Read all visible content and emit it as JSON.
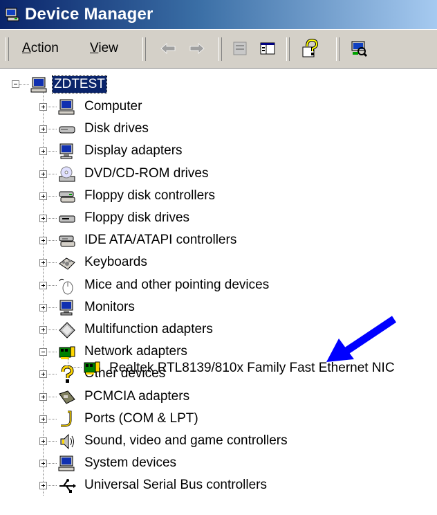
{
  "window": {
    "title": "Device Manager",
    "title_icon": "device-manager-icon",
    "colors": {
      "title_start": "#0a246a",
      "title_end": "#a6caf0",
      "toolbar_bg": "#d4d0c8",
      "selection": "#0a246a",
      "arrow": "#0000ff"
    }
  },
  "menu": {
    "items": [
      {
        "label": "Action",
        "underline_char": "A",
        "rest": "ction"
      },
      {
        "label": "View",
        "underline_char": "V",
        "rest": "iew"
      }
    ]
  },
  "toolbar": {
    "buttons": [
      {
        "name": "back-button",
        "icon": "back-arrow-icon",
        "enabled": false
      },
      {
        "name": "forward-button",
        "icon": "forward-arrow-icon",
        "enabled": false
      },
      {
        "name": "up-button",
        "icon": "properties-icon",
        "enabled": false
      },
      {
        "name": "show-hide-tree-button",
        "icon": "console-tree-icon",
        "enabled": true
      },
      {
        "name": "help-button",
        "icon": "help-icon",
        "enabled": true
      },
      {
        "name": "scan-hardware-button",
        "icon": "scan-hardware-icon",
        "enabled": true
      }
    ]
  },
  "tree": {
    "root": {
      "label": "ZDTEST",
      "icon": "computer-icon",
      "expanded": true,
      "selected": true
    },
    "categories": [
      {
        "label": "Computer",
        "icon": "computer-icon",
        "expanded": false
      },
      {
        "label": "Disk drives",
        "icon": "disk-drive-icon",
        "expanded": false
      },
      {
        "label": "Display adapters",
        "icon": "display-adapter-icon",
        "expanded": false
      },
      {
        "label": "DVD/CD-ROM drives",
        "icon": "cd-rom-icon",
        "expanded": false
      },
      {
        "label": "Floppy disk controllers",
        "icon": "floppy-controller-icon",
        "expanded": false
      },
      {
        "label": "Floppy disk drives",
        "icon": "floppy-drive-icon",
        "expanded": false
      },
      {
        "label": "IDE ATA/ATAPI controllers",
        "icon": "ide-controller-icon",
        "expanded": false
      },
      {
        "label": "Keyboards",
        "icon": "keyboard-icon",
        "expanded": false
      },
      {
        "label": "Mice and other pointing devices",
        "icon": "mouse-icon",
        "expanded": false
      },
      {
        "label": "Monitors",
        "icon": "monitor-icon",
        "expanded": false
      },
      {
        "label": "Multifunction adapters",
        "icon": "multifunction-icon",
        "expanded": false
      },
      {
        "label": "Network adapters",
        "icon": "network-adapter-icon",
        "expanded": true,
        "children": [
          {
            "label": "Realtek RTL8139/810x Family Fast Ethernet NIC",
            "icon": "network-adapter-icon"
          }
        ]
      },
      {
        "label": "Other devices",
        "icon": "question-mark-icon",
        "expanded": false
      },
      {
        "label": "PCMCIA adapters",
        "icon": "pcmcia-icon",
        "expanded": false
      },
      {
        "label": "Ports (COM & LPT)",
        "icon": "port-icon",
        "expanded": false
      },
      {
        "label": "Sound, video and game controllers",
        "icon": "speaker-icon",
        "expanded": false
      },
      {
        "label": "System devices",
        "icon": "computer-icon",
        "expanded": false
      },
      {
        "label": "Universal Serial Bus controllers",
        "icon": "usb-icon",
        "expanded": false
      }
    ]
  },
  "annotation": {
    "type": "blue-arrow",
    "points_to": "Realtek RTL8139/810x Family Fast Ethernet NIC"
  }
}
